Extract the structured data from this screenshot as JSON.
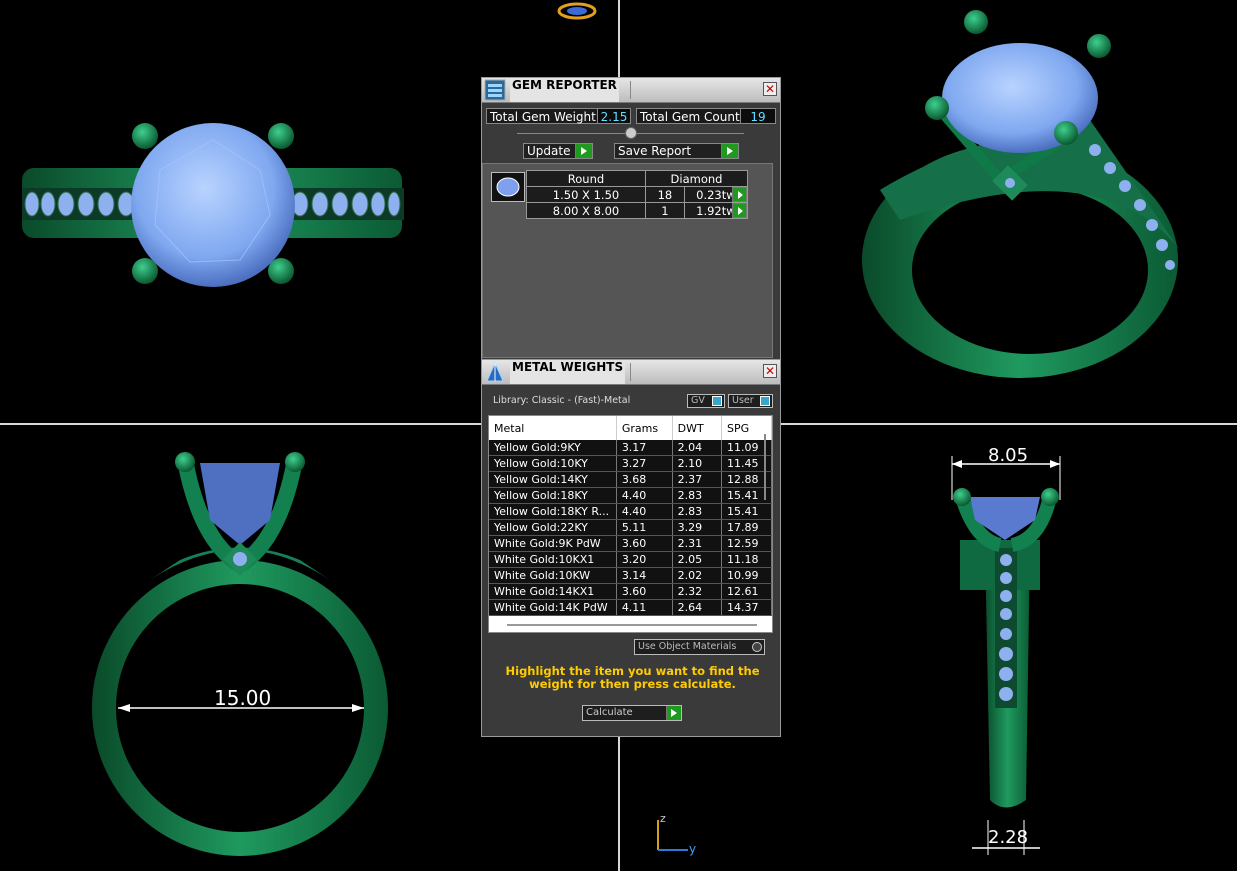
{
  "viewport": {
    "dim_ring_size": "15.00",
    "dim_top_width": "8.05",
    "dim_shank_width": "2.28",
    "axis_z": "z",
    "axis_y": "y"
  },
  "gem_reporter": {
    "title": "GEM REPORTER",
    "close": "✕",
    "total_weight_label": "Total Gem Weight",
    "total_weight_value": "2.15",
    "total_count_label": "Total Gem Count",
    "total_count_value": "19",
    "update_button": "Update",
    "save_report_button": "Save Report",
    "header_shape": "Round",
    "header_material": "Diamond",
    "rows": [
      {
        "size": "1.50 X 1.50",
        "count": "18",
        "weight": "0.23tw"
      },
      {
        "size": "8.00 X 8.00",
        "count": "1",
        "weight": "1.92tw"
      }
    ]
  },
  "metal_weights": {
    "title": "METAL WEIGHTS",
    "close": "✕",
    "library": "Library: Classic - (Fast)-Metal",
    "gv_toggle": "GV",
    "user_toggle": "User",
    "columns": [
      "Metal",
      "Grams",
      "DWT",
      "SPG"
    ],
    "rows": [
      [
        "Yellow Gold:9KY",
        "3.17",
        "2.04",
        "11.09"
      ],
      [
        "Yellow Gold:10KY",
        "3.27",
        "2.10",
        "11.45"
      ],
      [
        "Yellow Gold:14KY",
        "3.68",
        "2.37",
        "12.88"
      ],
      [
        "Yellow Gold:18KY",
        "4.40",
        "2.83",
        "15.41"
      ],
      [
        "Yellow Gold:18KY R...",
        "4.40",
        "2.83",
        "15.41"
      ],
      [
        "Yellow Gold:22KY",
        "5.11",
        "3.29",
        "17.89"
      ],
      [
        "White Gold:9K PdW",
        "3.60",
        "2.31",
        "12.59"
      ],
      [
        "White Gold:10KX1",
        "3.20",
        "2.05",
        "11.18"
      ],
      [
        "White Gold:10KW",
        "3.14",
        "2.02",
        "10.99"
      ],
      [
        "White Gold:14KX1",
        "3.60",
        "2.32",
        "12.61"
      ],
      [
        "White Gold:14K PdW",
        "4.11",
        "2.64",
        "14.37"
      ]
    ],
    "use_object_materials": "Use Object Materials",
    "instruction": "Highlight the item you want to find the weight for then press calculate.",
    "calculate_button": "Calculate"
  }
}
